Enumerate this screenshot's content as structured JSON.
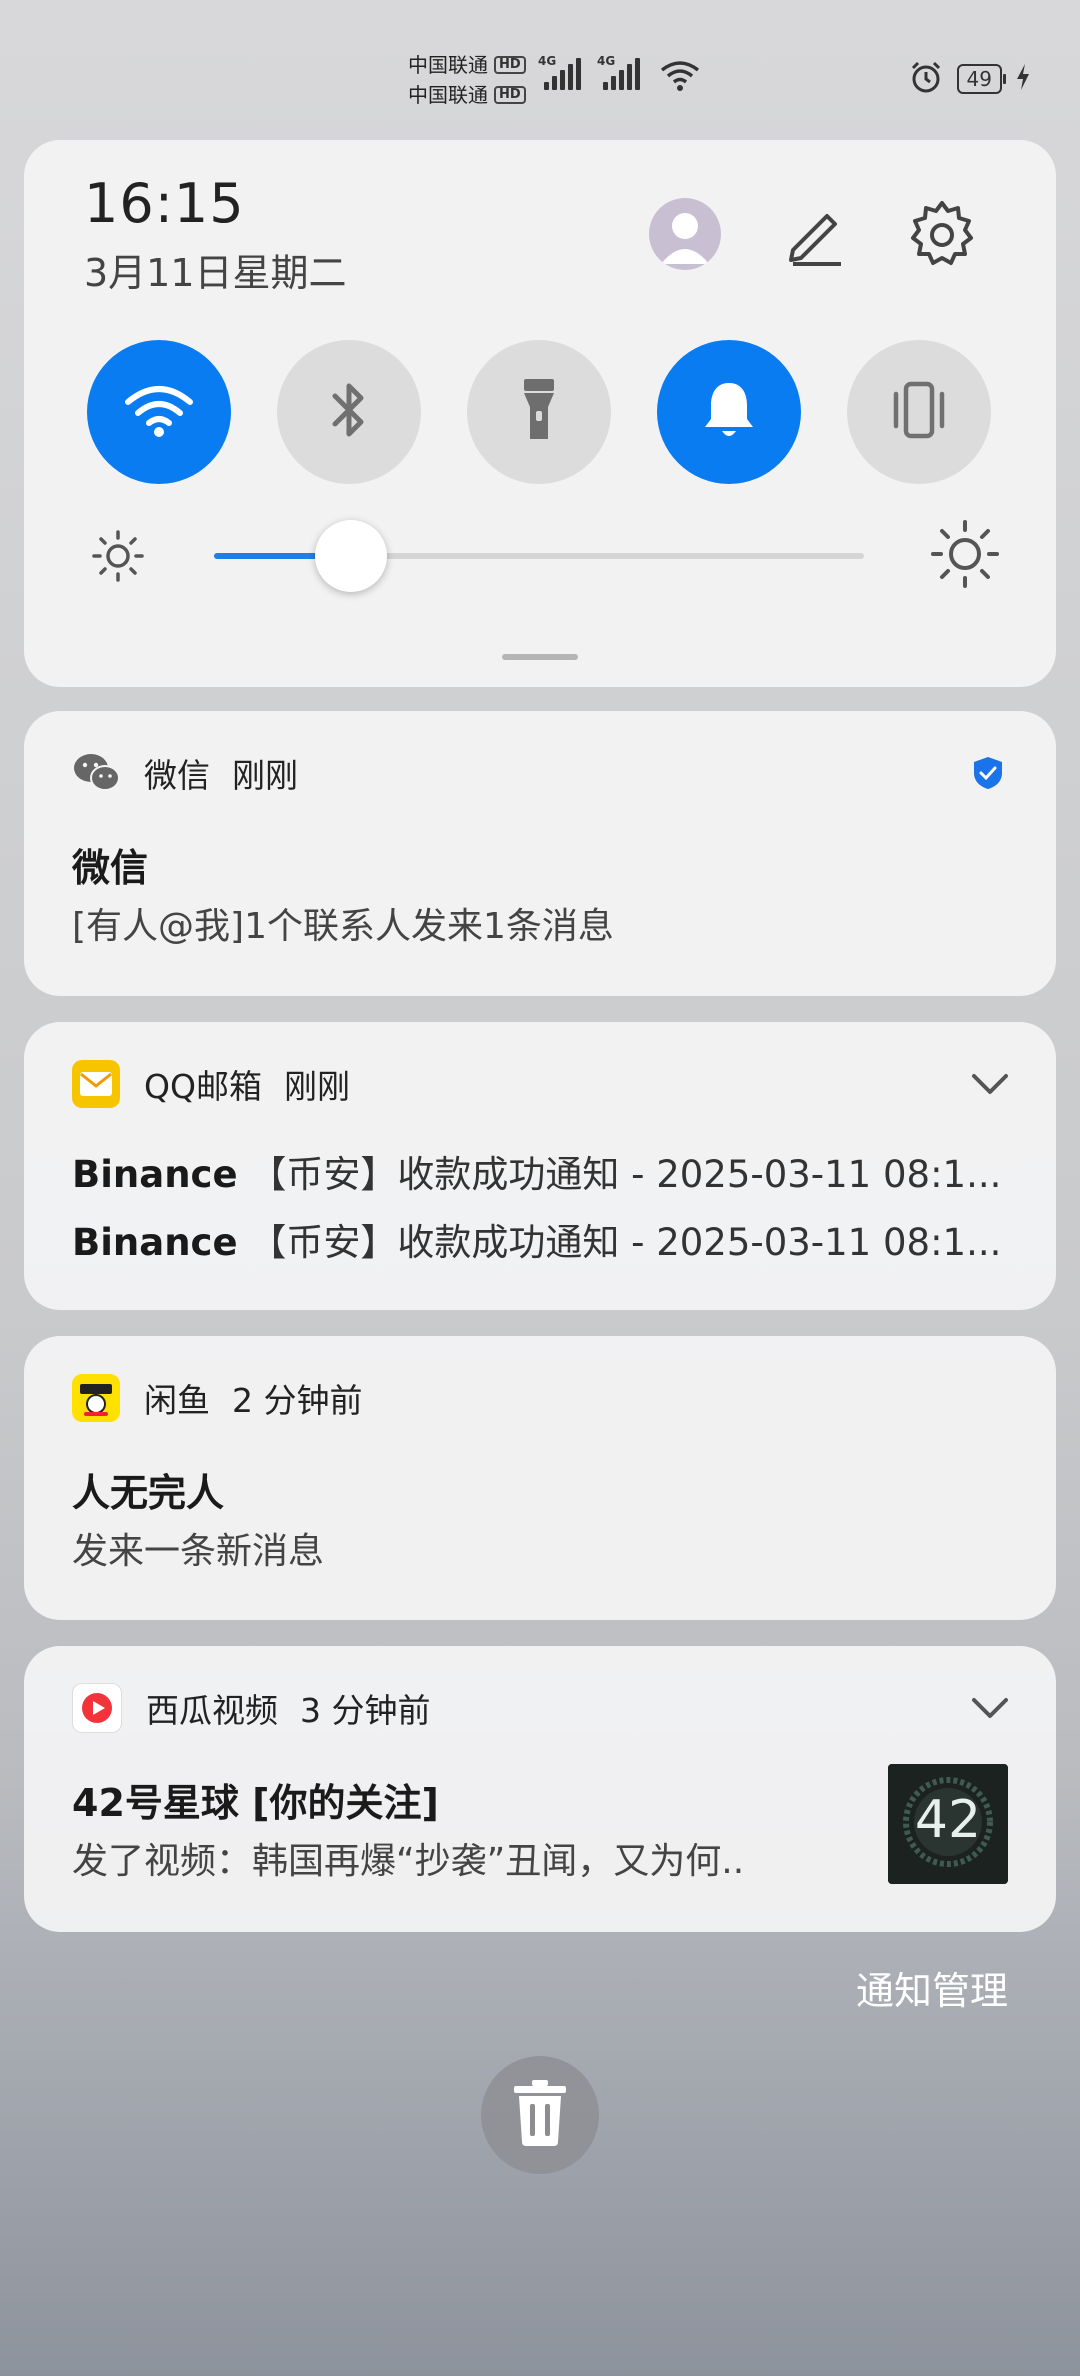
{
  "status_bar": {
    "carrier_1": "中国联通",
    "carrier_2": "中国联通",
    "hd_label": "HD",
    "network_type": "4G",
    "battery": "49"
  },
  "quick_settings": {
    "time": "16:15",
    "date": "3月11日星期二",
    "toggles": [
      {
        "icon": "wifi-icon",
        "state": "on"
      },
      {
        "icon": "bluetooth-icon",
        "state": "off"
      },
      {
        "icon": "flashlight-icon",
        "state": "off"
      },
      {
        "icon": "bell-icon",
        "state": "on"
      },
      {
        "icon": "vibrate-icon",
        "state": "off"
      }
    ],
    "brightness_level": 0.21,
    "accent_color": "#0a7cf2"
  },
  "notifications": [
    {
      "app": "微信",
      "time": "刚刚",
      "title": "微信",
      "body": "[有人@我]1个联系人发来1条消息",
      "icon": "wechat-icon"
    },
    {
      "app": "QQ邮箱",
      "time": "刚刚",
      "icon": "qqmail-icon",
      "lines": [
        {
          "sender": "Binance",
          "subject": "【币安】收款成功通知 - 2025-03-11 08:1..."
        },
        {
          "sender": "Binance",
          "subject": "【币安】收款成功通知 - 2025-03-11 08:1..."
        }
      ]
    },
    {
      "app": "闲鱼",
      "time": "2 分钟前",
      "title": "人无完人",
      "body": "发来一条新消息",
      "icon": "xianyu-icon"
    },
    {
      "app": "西瓜视频",
      "time": "3 分钟前",
      "title": "42号星球 [你的关注]",
      "body": "发了视频：韩国再爆“抄袭”丑闻，又为何..",
      "icon": "xigua-icon",
      "thumbnail_text": "42"
    }
  ],
  "footer": {
    "manage_label": "通知管理"
  }
}
